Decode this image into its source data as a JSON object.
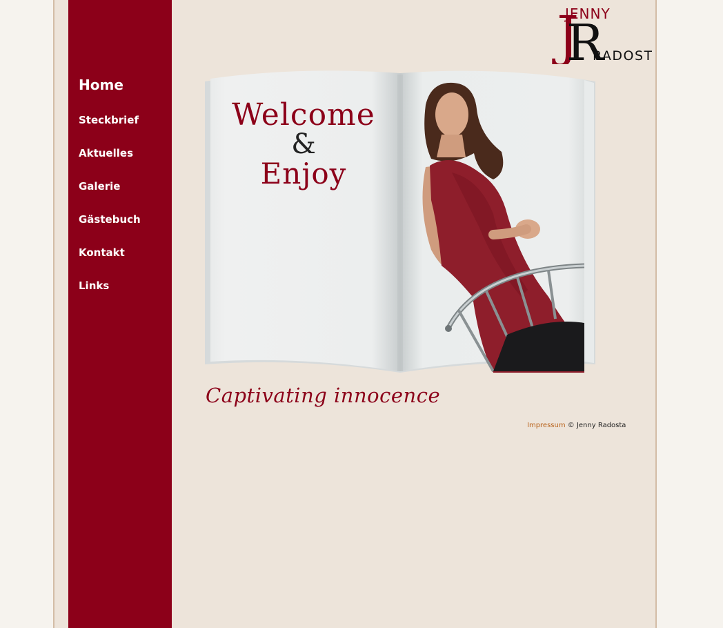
{
  "logo": {
    "first_name": "JENNY",
    "last_name": "RADOSTA",
    "monogram_j": "J",
    "monogram_r": "R"
  },
  "nav": {
    "items": [
      {
        "label": "Home",
        "active": true
      },
      {
        "label": "Steckbrief"
      },
      {
        "label": "Aktuelles"
      },
      {
        "label": "Galerie"
      },
      {
        "label": "Gästebuch"
      },
      {
        "label": "Kontakt"
      },
      {
        "label": "Links"
      }
    ]
  },
  "hero": {
    "welcome_line1": "Welcome",
    "welcome_amp": "&",
    "welcome_line2": "Enjoy",
    "tagline": "Captivating innocence"
  },
  "footer": {
    "impressum_label": "Impressum",
    "copyright": "© Jenny Radosta"
  },
  "colors": {
    "brand": "#8c0019",
    "background": "#ede4da",
    "outer": "#f6f3ee",
    "link": "#b8621b"
  }
}
